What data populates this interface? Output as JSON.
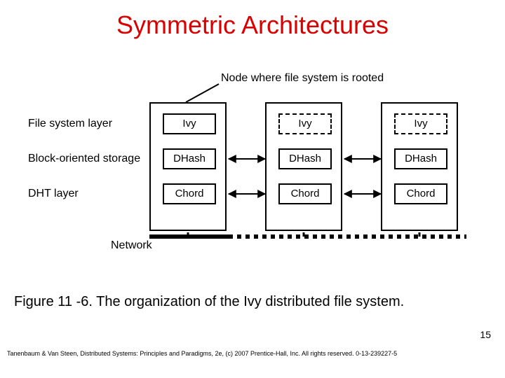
{
  "title": "Symmetric Architectures",
  "annotations": {
    "top": "Node where file system is rooted",
    "file_system": "File system layer",
    "block_storage": "Block-oriented storage",
    "dht": "DHT layer",
    "network": "Network"
  },
  "boxes": {
    "ivy": "Ivy",
    "dhash": "DHash",
    "chord": "Chord"
  },
  "caption": "Figure 11 -6. The organization of the Ivy distributed file system.",
  "page_number": "15",
  "footer": "Tanenbaum & Van Steen, Distributed Systems: Principles and Paradigms, 2e, (c) 2007 Prentice-Hall, Inc. All rights reserved. 0-13-239227-5"
}
